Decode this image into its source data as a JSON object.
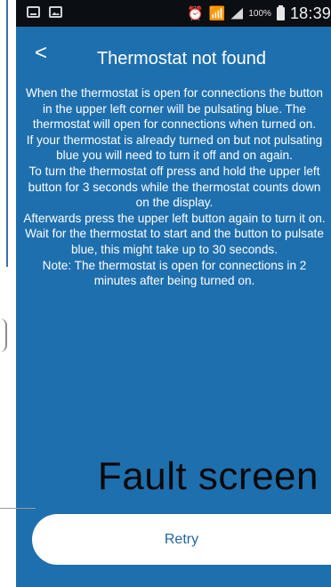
{
  "status_bar": {
    "left_icons": [
      "message-icon",
      "image-icon"
    ],
    "right_icons": [
      "alarm-icon",
      "wifi-icon",
      "signal-icon"
    ],
    "battery_percent": "100%",
    "time": "18:39"
  },
  "header": {
    "back_glyph": "<",
    "title": "Thermostat not found"
  },
  "body": {
    "paragraphs": [
      "When the thermostat is open for connections the button in the upper left corner will be pulsating blue. The thermostat will open for connections when turned on.",
      "If your thermostat is already turned on but not pulsating blue you will need to turn it off and on again.",
      "To turn the thermostat off press and hold the upper left button for 3 seconds while the thermostat counts down on the display.",
      "Afterwards press the upper left button again to turn it on. Wait for the thermostat to start and the button to pulsate blue, this might take up to 30 seconds.",
      "Note: The thermostat is open for connections in 2 minutes after being turned on."
    ]
  },
  "caption": "Fault screen",
  "retry_label": "Retry",
  "colors": {
    "background": "#1e6fae",
    "status_bar": "#0b0e12",
    "button": "#ffffff",
    "button_text": "#2163a4"
  }
}
